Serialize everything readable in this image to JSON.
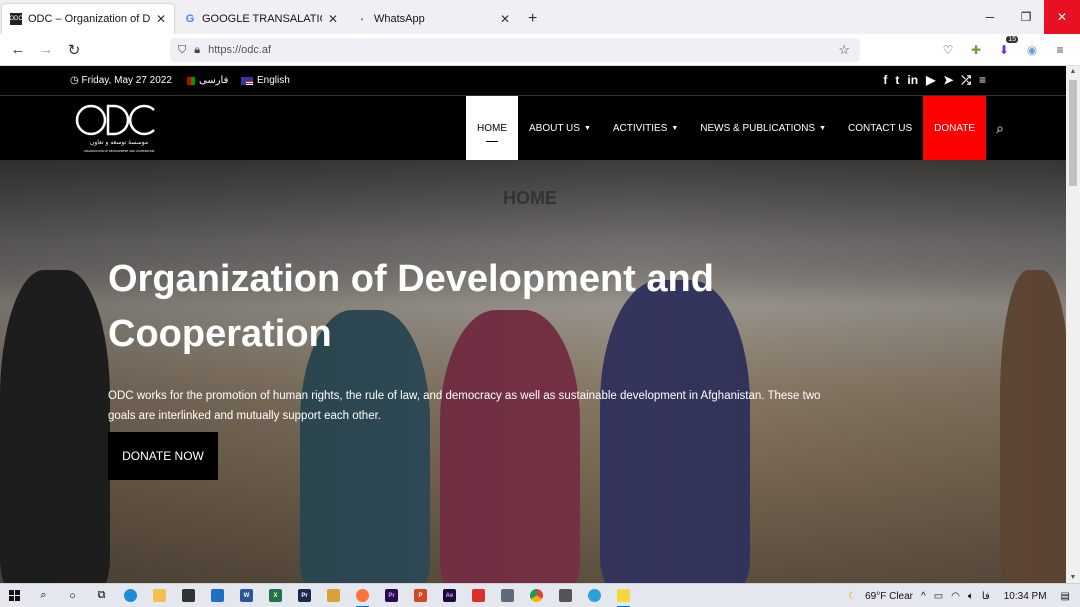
{
  "browser": {
    "tabs": [
      {
        "title": "ODC – Organization of Develop",
        "favicon": "odc-logo",
        "active": true
      },
      {
        "title": "GOOGLE TRANSALATION - Goo",
        "favicon": "google-icon",
        "active": false
      },
      {
        "title": "WhatsApp",
        "favicon": "whatsapp-dot",
        "active": false
      }
    ],
    "url": "https://odc.af",
    "extension_badge": "15"
  },
  "site": {
    "topbar": {
      "date": "Friday, May 27 2022",
      "lang_persian": "فارسی",
      "lang_english": "English",
      "social": [
        "facebook-icon",
        "twitter-icon",
        "linkedin-icon",
        "youtube-icon",
        "telegram-icon",
        "shuffle-icon",
        "menu-icon"
      ]
    },
    "logo": {
      "text": "ODC",
      "sub_farsi": "موسسهٔ توسعه و تعاون",
      "sub_en": "ORGANIZATION OF DEVELOPMENT AND COOPERATION"
    },
    "menu": {
      "home": "HOME",
      "about": "ABOUT US",
      "activities": "ACTIVITIES",
      "news": "NEWS & PUBLICATIONS",
      "contact": "CONTACT US",
      "donate": "DONATE"
    },
    "hero": {
      "page_label": "HOME",
      "title": "Organization of Development and Cooperation",
      "description": "ODC works for the promotion of human rights, the rule of law, and democracy as well as sustainable development in Afghanistan. These two goals are interlinked and mutually support each other.",
      "button": "DONATE NOW"
    }
  },
  "taskbar": {
    "weather": "69°F  Clear",
    "lang": "فا",
    "time": "10:34 PM"
  },
  "colors": {
    "accent_red": "#ff0000",
    "close_red": "#e81123",
    "nav_black": "#000000"
  }
}
